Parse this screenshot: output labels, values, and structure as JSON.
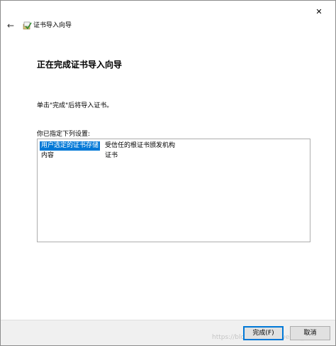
{
  "window": {
    "close_glyph": "✕"
  },
  "nav": {
    "back_glyph": "←",
    "title": "证书导入向导"
  },
  "content": {
    "heading": "正在完成证书导入向导",
    "description": "单击\"完成\"后将导入证书。",
    "settings_label": "你已指定下列设置:",
    "settings": [
      {
        "key": "用户选定的证书存储",
        "value": "受信任的根证书颁发机构",
        "selected": true
      },
      {
        "key": "内容",
        "value": "证书",
        "selected": false
      }
    ]
  },
  "footer": {
    "finish_label": "完成(F)",
    "cancel_label": "取消",
    "watermark": "https://blog.csdn.net/weixin_4..."
  },
  "colors": {
    "selection": "#0078d7",
    "footer_bg": "#f0f0f0",
    "button_bg": "#e1e1e1"
  },
  "icons": {
    "back": "arrow-left-icon",
    "wizard": "certificate-wizard-icon",
    "close": "close-icon"
  }
}
